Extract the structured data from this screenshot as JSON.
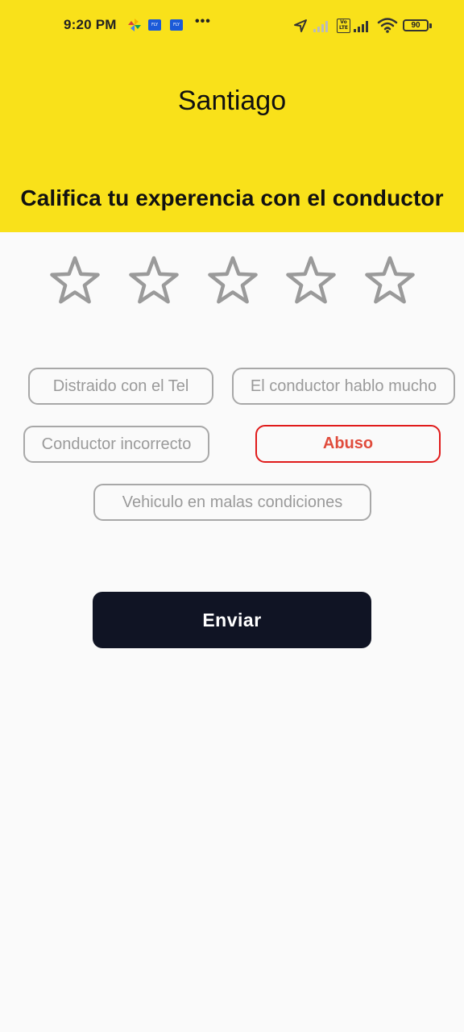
{
  "status_bar": {
    "time": "9:20 PM",
    "notification_icons": [
      "pinwheel-icon",
      "fly-icon",
      "fly-icon",
      "more-dots-icon"
    ],
    "fly_label": "FLY",
    "more": "•••",
    "volte_label": "Vo LTE",
    "battery_level": "90",
    "system_icons": [
      "location-arrow-icon",
      "signal-icon",
      "volte-icon",
      "signal-icon",
      "wifi-icon",
      "battery-icon"
    ]
  },
  "header": {
    "driver_name": "Santiago",
    "title": "Califica tu experencia con el conductor",
    "background_color": "#f9e11a"
  },
  "rating": {
    "max_stars": 5,
    "selected_stars": 0,
    "star_color": "#9a9a9a"
  },
  "feedback_options": [
    {
      "label": "Distraido con el Tel",
      "selected": false
    },
    {
      "label": "El conductor hablo mucho",
      "selected": false
    },
    {
      "label": "Conductor incorrecto",
      "selected": false
    },
    {
      "label": "Abuso",
      "selected": true
    },
    {
      "label": "Vehiculo en malas condiciones",
      "selected": false
    }
  ],
  "submit": {
    "label": "Enviar",
    "background_color": "#101424"
  },
  "colors": {
    "chip_border": "#a8a8a8",
    "chip_selected_border": "#e01b1b",
    "chip_selected_text": "#e04c3c",
    "page_background": "#fafafa"
  }
}
